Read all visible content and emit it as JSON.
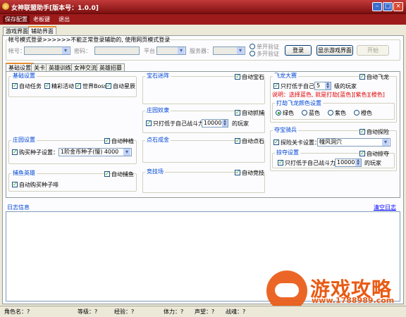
{
  "titlebar": {
    "title": "女神联盟助手[版本号：1.0.0]"
  },
  "menu": {
    "items": [
      "保存配置",
      "老板键",
      "退出"
    ]
  },
  "main_tabs": [
    "游戏界面",
    "辅助界面"
  ],
  "login": {
    "title": "帐号模式登录>>>>>>不能正常登录辅助的, 使用网页模式登录",
    "account_label": "帐号：",
    "password_label": "密码：",
    "platform_label": "平台",
    "server_label": "服务器：",
    "verify_single": "单开验证",
    "verify_multi": "多开验证",
    "login_button": "登录",
    "show_game_button": "显示游戏界面",
    "start_button": "开始"
  },
  "sub_tabs": [
    "基础设置",
    "关卡",
    "英雄训练",
    "女神交流",
    "英雄招募"
  ],
  "basic": {
    "title": "基础设置",
    "auto_task": "自动任务",
    "event": "精彩活动",
    "world_boss": "世界Boss",
    "auto_star": "自动星辰"
  },
  "manor": {
    "title": "庄园设置",
    "auto_plant": "自动种植",
    "buy_seed": "购买种子设置：",
    "seed_select": "1阶金币种子(慢)",
    "seed_amount": "4000"
  },
  "fishing": {
    "title": "捕鱼英雄",
    "auto_fish": "自动捕鱼",
    "auto_buy_seed": "自动购买种子啡"
  },
  "treasure": {
    "title": "宝石迷阵",
    "auto_gem": "自动宝石"
  },
  "slave": {
    "title": "庄园奴隶",
    "auto_catch": "自动抓捕",
    "only_hit": "只打低于自己战斗力",
    "power": "10000",
    "players": "的玩家"
  },
  "stone": {
    "title": "点石成金",
    "auto_stone": "自动点石"
  },
  "arena": {
    "title": "竞技场",
    "auto_arena": "自动竞技"
  },
  "dragon": {
    "title": "飞龙大赛",
    "auto_dragon": "自动飞龙",
    "only_hit": "只打低于自己",
    "level": "5",
    "level_suffix": "级的玩家",
    "note": "说明：选择蓝色, 就是打劫[蓝色][紫色][橙色]",
    "color_title": "打劫飞龙颜色设置",
    "green": "绿色",
    "blue": "蓝色",
    "purple": "紫色",
    "orange": "橙色"
  },
  "treasure_hunt": {
    "title": "夺宝骑兵",
    "auto_explore": "自动探险",
    "explore_label": "探险关卡设置：",
    "explore_select": "幢风洞穴",
    "plunder_title": "掠夺设置",
    "auto_plunder": "自动掠夺",
    "only_hit": "只打低于自己战斗力",
    "power": "10000",
    "players": "的玩家"
  },
  "log": {
    "title": "日志信息",
    "clear": "清空日志"
  },
  "watermark": {
    "text": "游戏攻略",
    "url": "www.1788989.com"
  },
  "status": {
    "name": "角色名：?",
    "level": "等级：?",
    "exp": "经验：?",
    "stamina": "体力：?",
    "fame": "声望：?",
    "combat": "战魂：?"
  },
  "colors": {
    "title_red": "#9d1b1b",
    "accent_blue": "#0046d5",
    "note_red": "#e00000",
    "watermark": "#ea5a14"
  }
}
